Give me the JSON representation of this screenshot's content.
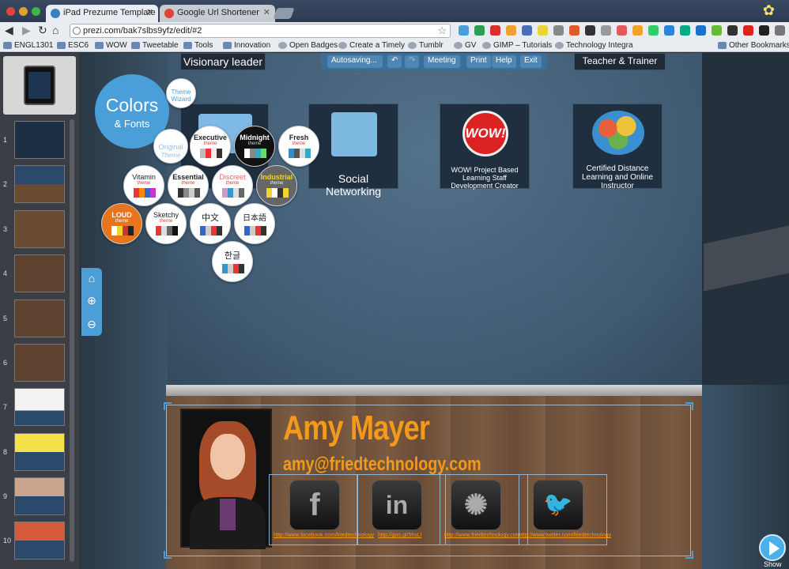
{
  "browser": {
    "tabs": [
      {
        "title": "iPad Prezume Template",
        "active": true
      },
      {
        "title": "Google Url Shortener",
        "active": false
      }
    ],
    "url": "prezi.com/bak7slbs9yfz/edit/#2",
    "bookmarks": [
      "ENGL1301",
      "ESC6",
      "WOW",
      "Tweetable",
      "Tools",
      "Innovation",
      "Open Badges",
      "Create a Timely",
      "Tumblr",
      "GV",
      "GIMP – Tutorials",
      "Technology Integra",
      "Other Bookmarks"
    ]
  },
  "toolbar": {
    "autosave": "Autosaving...",
    "meeting": "Meeting",
    "print": "Print",
    "help": "Help",
    "exit": "Exit"
  },
  "colors_fonts": {
    "title": "Colors",
    "subtitle": "& Fonts",
    "wizard": "Theme Wizard"
  },
  "themes": [
    {
      "name": "Original",
      "sub": "Theme"
    },
    {
      "name": "Executive",
      "sub": "theme"
    },
    {
      "name": "Midnight",
      "sub": "theme"
    },
    {
      "name": "Fresh",
      "sub": "theme"
    },
    {
      "name": "Vitamin",
      "sub": "theme"
    },
    {
      "name": "Essential",
      "sub": "theme"
    },
    {
      "name": "Discreet",
      "sub": "theme"
    },
    {
      "name": "Industrial",
      "sub": "theme"
    },
    {
      "name": "LOUD",
      "sub": "theme"
    },
    {
      "name": "Sketchy",
      "sub": "theme"
    },
    {
      "name": "中文",
      "sub": ""
    },
    {
      "name": "日本語",
      "sub": ""
    },
    {
      "name": "한글",
      "sub": ""
    }
  ],
  "canvas": {
    "top_left": "Visionary leader",
    "top_right": "Teacher & Trainer",
    "panel_social": "Social Networking",
    "panel_wow": "WOW! Project Based Learning Staff Development Creator",
    "panel_wow_logo": "WOW!",
    "panel_cert": "Certified Distance Learning and Online Instructor",
    "name": "Amy Mayer",
    "email": "amy@friedtechnology.com",
    "links": [
      "http://www.facebook.com/friedtechnology",
      "http://goo.gl/5hsLl",
      "http://www.friedtechnology.com",
      "http://www.twitter.com/friedtechnology"
    ]
  },
  "slides": {
    "numbers": [
      "1",
      "2",
      "3",
      "4",
      "5",
      "6",
      "7",
      "8",
      "9",
      "10"
    ]
  },
  "show_label": "Show"
}
